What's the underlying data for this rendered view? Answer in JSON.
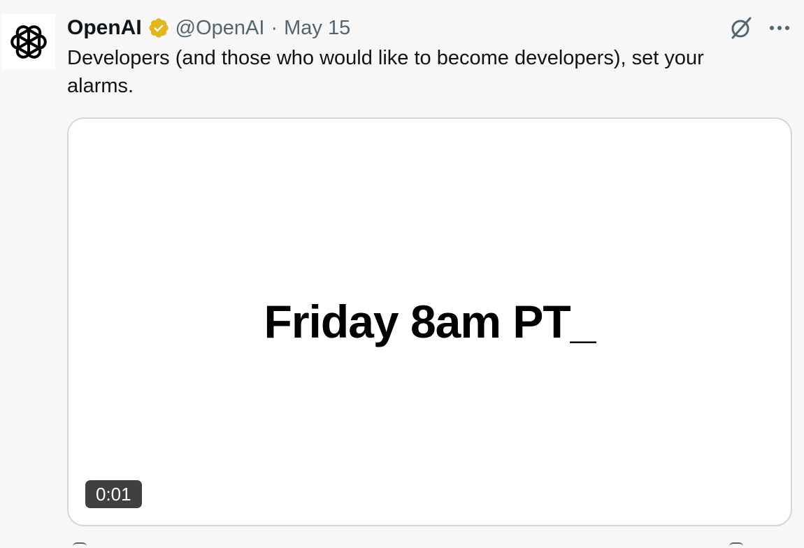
{
  "tweet": {
    "author_name": "OpenAI",
    "handle": "@OpenAI",
    "separator": "·",
    "date": "May 15",
    "text": "Developers (and those who would like to become developers), set your alarms.",
    "verified_color": "#e2b719",
    "avatar_icon": "openai-logo-icon"
  },
  "media": {
    "overlay_text": "Friday 8am PT_",
    "duration": "0:01"
  },
  "actions": {
    "grok_icon": "grok-icon",
    "more_icon": "more-icon"
  }
}
